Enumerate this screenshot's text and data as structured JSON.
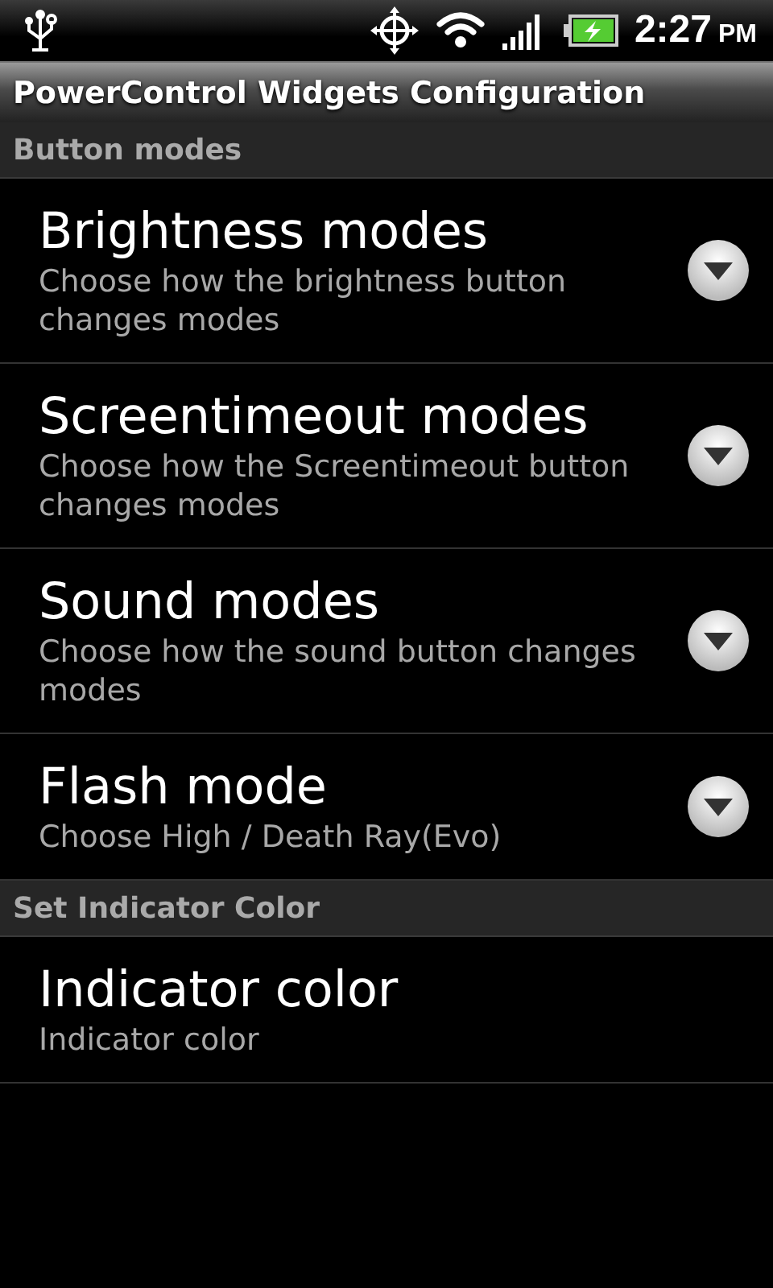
{
  "status_bar": {
    "time": "2:27",
    "ampm": "PM"
  },
  "title_bar": {
    "title": "PowerControl Widgets Configuration"
  },
  "sections": [
    {
      "header": "Button modes",
      "items": [
        {
          "kind": "list",
          "title": "Brightness modes",
          "summary": "Choose how the brightness button changes modes"
        },
        {
          "kind": "list",
          "title": "Screentimeout modes",
          "summary": "Choose how the Screentimeout button changes modes"
        },
        {
          "kind": "list",
          "title": "Sound modes",
          "summary": "Choose how the sound button changes modes"
        },
        {
          "kind": "list",
          "title": "Flash mode",
          "summary": "Choose High / Death Ray(Evo)"
        }
      ]
    },
    {
      "header": "Set Indicator Color",
      "items": [
        {
          "kind": "plain",
          "title": "Indicator color",
          "summary": "Indicator color"
        }
      ]
    }
  ]
}
